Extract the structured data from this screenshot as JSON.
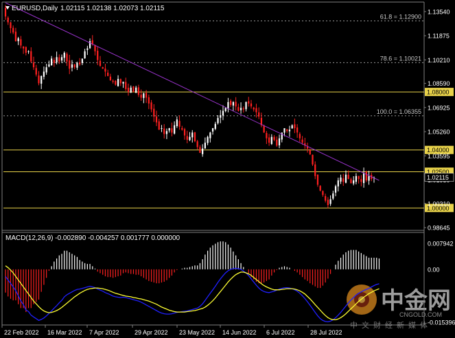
{
  "header": {
    "symbol_label": "EURUSD,Daily",
    "ohlc": "1.02115 1.02138 1.02073 1.02115"
  },
  "macd_header": {
    "label": "MACD(12,26,9) -0.002890 -0.004257 0.001777 0.000000"
  },
  "fib_levels": [
    {
      "label": "61.8 = 1.12900",
      "price": 1.129
    },
    {
      "label": "78.6 = 1.10021",
      "price": 1.10021
    },
    {
      "label": "100.0 = 1.06355",
      "price": 1.06355
    }
  ],
  "horizontal_levels": [
    {
      "label": "1.08000",
      "price": 1.08
    },
    {
      "label": "1.04000",
      "price": 1.04
    },
    {
      "label": "1.02500",
      "price": 1.025
    },
    {
      "label": "1.00000",
      "price": 1.0
    }
  ],
  "price_axis": {
    "ticks": [
      "1.13540",
      "1.11875",
      "1.10210",
      "1.08590",
      "1.06925",
      "1.05260",
      "1.03595",
      "1.01930",
      "1.00310",
      "0.98645"
    ],
    "current_price": "1.02115"
  },
  "macd_axis": {
    "ticks": [
      "0.007942",
      "0.00",
      "-0.015396"
    ]
  },
  "time_axis": {
    "labels": [
      "22 Feb 2022",
      "16 Mar 2022",
      "7 Apr 2022",
      "29 Apr 2022",
      "23 May 2022",
      "14 Jun 2022",
      "6 Jul 2022",
      "28 Jul 2022"
    ]
  },
  "watermark": {
    "brand": "中金网",
    "url": "CNGOLD.COM",
    "slogan": "中文财经新媒体"
  },
  "colors": {
    "background": "#000000",
    "bull_candle": "#ffffff",
    "bear_candle": "#ff2020",
    "trendline": "#9933cc",
    "level_line": "#e8d24a",
    "fib_line": "#9a9a9a",
    "macd_line": "#2020ff",
    "signal_line": "#ffff33",
    "hist_pos": "#ffffff",
    "hist_neg": "#ff2020"
  },
  "chart_data": {
    "type": "candlestick",
    "symbol": "EURUSD",
    "timeframe": "Daily",
    "ylim": [
      0.9855,
      1.1415
    ],
    "closes": [
      1.132,
      1.128,
      1.124,
      1.121,
      1.115,
      1.117,
      1.112,
      1.11,
      1.107,
      1.108,
      1.101,
      1.097,
      1.092,
      1.086,
      1.091,
      1.094,
      1.097,
      1.099,
      1.103,
      1.1,
      1.104,
      1.101,
      1.104,
      1.107,
      1.101,
      1.096,
      1.099,
      1.097,
      1.1,
      1.099,
      1.103,
      1.108,
      1.11,
      1.115,
      1.113,
      1.108,
      1.102,
      1.098,
      1.096,
      1.094,
      1.091,
      1.088,
      1.087,
      1.085,
      1.089,
      1.086,
      1.087,
      1.082,
      1.08,
      1.083,
      1.08,
      1.083,
      1.078,
      1.076,
      1.079,
      1.076,
      1.072,
      1.068,
      1.063,
      1.059,
      1.054,
      1.055,
      1.051,
      1.053,
      1.055,
      1.052,
      1.057,
      1.061,
      1.056,
      1.054,
      1.05,
      1.047,
      1.049,
      1.052,
      1.046,
      1.042,
      1.038,
      1.041,
      1.045,
      1.049,
      1.052,
      1.055,
      1.058,
      1.062,
      1.064,
      1.067,
      1.069,
      1.073,
      1.071,
      1.073,
      1.07,
      1.067,
      1.069,
      1.068,
      1.073,
      1.072,
      1.07,
      1.068,
      1.066,
      1.063,
      1.057,
      1.052,
      1.048,
      1.045,
      1.049,
      1.047,
      1.043,
      1.048,
      1.052,
      1.055,
      1.053,
      1.054,
      1.057,
      1.055,
      1.052,
      1.048,
      1.045,
      1.043,
      1.041,
      1.037,
      1.03,
      1.022,
      1.016,
      1.012,
      1.009,
      1.005,
      1.002,
      1.006,
      1.01,
      1.015,
      1.019,
      1.021,
      1.018,
      1.023,
      1.02,
      1.017,
      1.019,
      1.022,
      1.02,
      1.018,
      1.024,
      1.019,
      1.022,
      1.02,
      1.021
    ],
    "trendline": {
      "from": {
        "bar": 0,
        "price": 1.1415
      },
      "to": {
        "bar": 146,
        "price": 1.019
      }
    },
    "macd": [
      -0.002,
      -0.003,
      -0.004,
      -0.005,
      -0.006,
      -0.0075,
      -0.009,
      -0.01,
      -0.0115,
      -0.012,
      -0.013,
      -0.0135,
      -0.014,
      -0.0145,
      -0.0142,
      -0.0138,
      -0.0132,
      -0.0125,
      -0.0118,
      -0.011,
      -0.0103,
      -0.0095,
      -0.0088,
      -0.0078,
      -0.0072,
      -0.0068,
      -0.0064,
      -0.006,
      -0.0057,
      -0.0056,
      -0.0054,
      -0.0052,
      -0.005,
      -0.0048,
      -0.005,
      -0.0052,
      -0.0056,
      -0.0059,
      -0.0062,
      -0.0066,
      -0.0069,
      -0.0072,
      -0.0076,
      -0.0078,
      -0.0079,
      -0.008,
      -0.0079,
      -0.008,
      -0.0082,
      -0.0084,
      -0.0086,
      -0.0088,
      -0.009,
      -0.0093,
      -0.0097,
      -0.0101,
      -0.0105,
      -0.0109,
      -0.0113,
      -0.0117,
      -0.0121,
      -0.0124,
      -0.0126,
      -0.0127,
      -0.0127,
      -0.0126,
      -0.0124,
      -0.0122,
      -0.0121,
      -0.012,
      -0.0119,
      -0.0118,
      -0.0116,
      -0.0114,
      -0.0112,
      -0.011,
      -0.0105,
      -0.0098,
      -0.0088,
      -0.0078,
      -0.0068,
      -0.0058,
      -0.0048,
      -0.0037,
      -0.0027,
      -0.0018,
      -0.001,
      -0.0004,
      0.0,
      0.0002,
      0.0003,
      0.0002,
      0.0,
      -0.0005,
      -0.001,
      -0.0018,
      -0.0027,
      -0.0036,
      -0.0045,
      -0.0053,
      -0.0059,
      -0.0063,
      -0.0065,
      -0.0066,
      -0.0064,
      -0.0062,
      -0.0059,
      -0.0056,
      -0.0054,
      -0.0052,
      -0.0052,
      -0.0053,
      -0.0055,
      -0.0058,
      -0.0062,
      -0.0068,
      -0.0075,
      -0.0083,
      -0.0092,
      -0.0102,
      -0.0112,
      -0.0122,
      -0.0132,
      -0.014,
      -0.0145,
      -0.0148,
      -0.0149,
      -0.0147,
      -0.0143,
      -0.0137,
      -0.013,
      -0.0122,
      -0.0113,
      -0.0104,
      -0.0095,
      -0.0087,
      -0.008,
      -0.0073,
      -0.0068,
      -0.0064,
      -0.006,
      -0.0057,
      -0.0054,
      -0.005,
      -0.0046,
      -0.0043,
      -0.0041
    ],
    "signal": [
      0.001,
      0.0005,
      -0.0002,
      -0.001,
      -0.002,
      -0.003,
      -0.004,
      -0.005,
      -0.006,
      -0.007,
      -0.008,
      -0.009,
      -0.0098,
      -0.0106,
      -0.0113,
      -0.0118,
      -0.0121,
      -0.0123,
      -0.0122,
      -0.012,
      -0.0117,
      -0.0113,
      -0.0108,
      -0.0102,
      -0.0096,
      -0.009,
      -0.0084,
      -0.0078,
      -0.0073,
      -0.0068,
      -0.0064,
      -0.006,
      -0.0057,
      -0.0055,
      -0.0054,
      -0.0053,
      -0.0053,
      -0.0054,
      -0.0055,
      -0.0057,
      -0.0059,
      -0.0062,
      -0.0065,
      -0.0068,
      -0.007,
      -0.0072,
      -0.0074,
      -0.0076,
      -0.0077,
      -0.0078,
      -0.008,
      -0.0081,
      -0.0083,
      -0.0084,
      -0.0086,
      -0.0088,
      -0.009,
      -0.0093,
      -0.0096,
      -0.0099,
      -0.0103,
      -0.0107,
      -0.011,
      -0.0113,
      -0.0116,
      -0.0118,
      -0.012,
      -0.0121,
      -0.0121,
      -0.0121,
      -0.0121,
      -0.012,
      -0.0119,
      -0.0118,
      -0.0117,
      -0.0115,
      -0.0113,
      -0.0111,
      -0.0107,
      -0.0102,
      -0.0096,
      -0.0089,
      -0.0081,
      -0.0072,
      -0.0063,
      -0.0054,
      -0.0045,
      -0.0036,
      -0.0028,
      -0.0021,
      -0.0015,
      -0.0011,
      -0.0008,
      -0.0008,
      -0.001,
      -0.0013,
      -0.0017,
      -0.0023,
      -0.0029,
      -0.0035,
      -0.0041,
      -0.0046,
      -0.005,
      -0.0053,
      -0.0056,
      -0.0058,
      -0.0058,
      -0.0058,
      -0.0057,
      -0.0056,
      -0.0055,
      -0.0055,
      -0.0055,
      -0.0056,
      -0.0058,
      -0.0061,
      -0.0065,
      -0.007,
      -0.0077,
      -0.0084,
      -0.0092,
      -0.01,
      -0.0108,
      -0.0116,
      -0.0124,
      -0.0131,
      -0.0137,
      -0.0141,
      -0.0143,
      -0.0143,
      -0.0141,
      -0.0137,
      -0.0132,
      -0.0126,
      -0.0119,
      -0.0112,
      -0.0105,
      -0.0098,
      -0.0091,
      -0.0085,
      -0.0079,
      -0.0074,
      -0.0069,
      -0.0065,
      -0.0061,
      -0.0058,
      -0.0055
    ],
    "macd_ylim": [
      -0.015396,
      0.007942
    ]
  }
}
